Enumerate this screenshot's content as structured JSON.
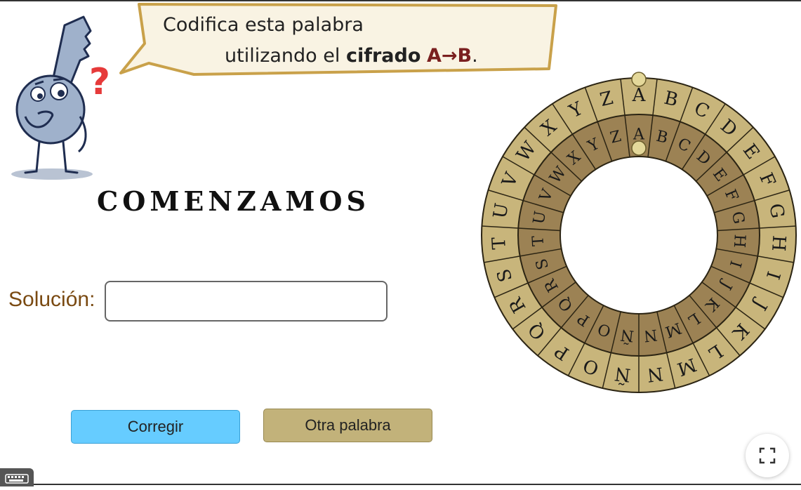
{
  "speech": {
    "line1": "Codifica esta palabra",
    "line2_prefix": "utilizando el ",
    "line2_bold": "cifrado",
    "line2_space": " ",
    "cipher": "A→B",
    "line2_end": "."
  },
  "mascot": {
    "question_mark": "?"
  },
  "title": "COMENZAMOS",
  "solution": {
    "label": "Solución:",
    "value": "",
    "placeholder": ""
  },
  "buttons": {
    "check_label": "Corregir",
    "other_label": "Otra palabra"
  },
  "wheel": {
    "outer_letters": [
      "A",
      "B",
      "C",
      "D",
      "E",
      "F",
      "G",
      "H",
      "I",
      "J",
      "K",
      "L",
      "M",
      "N",
      "Ñ",
      "O",
      "P",
      "Q",
      "R",
      "S",
      "T",
      "U",
      "V",
      "W",
      "X",
      "Y",
      "Z"
    ],
    "inner_letters": [
      "A",
      "B",
      "C",
      "D",
      "E",
      "F",
      "G",
      "H",
      "I",
      "J",
      "K",
      "L",
      "M",
      "N",
      "Ñ",
      "O",
      "P",
      "Q",
      "R",
      "S",
      "T",
      "U",
      "V",
      "W",
      "X",
      "Y",
      "Z"
    ],
    "colors": {
      "outer_ring": "#c8b57b",
      "inner_ring": "#9c8254",
      "border": "#2b2413",
      "handle": "#e4d89a"
    }
  },
  "icons": {
    "fullscreen": "fullscreen-icon",
    "keyboard": "keyboard-icon"
  }
}
